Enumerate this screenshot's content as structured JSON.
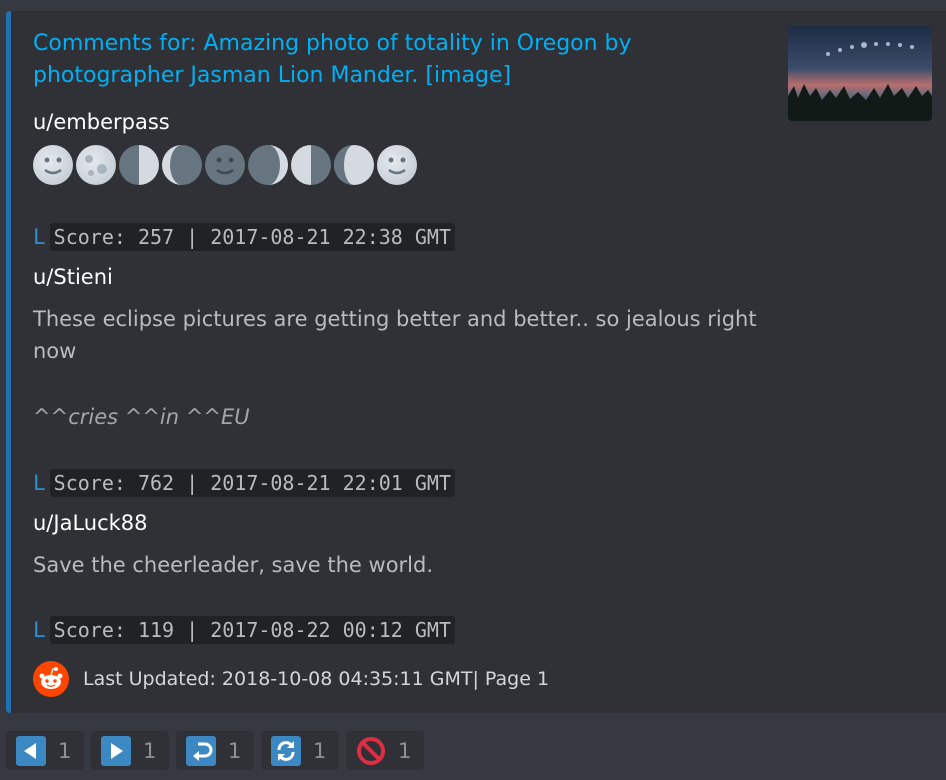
{
  "embed": {
    "title": "Comments for: Amazing photo of totality in Oregon by photographer Jasman Lion Mander. [image]",
    "post_author": "u/emberpass",
    "moon_emojis": [
      "full-moon-face-icon",
      "full-moon-icon",
      "waning-gibbous-icon",
      "last-quarter-icon",
      "new-moon-face-icon",
      "waning-crescent-icon",
      "first-quarter-icon",
      "waxing-gibbous-icon",
      "full-moon-face-icon"
    ],
    "comments": [
      {
        "score_line": "Score: 257 | 2017-08-21 22:38 GMT",
        "author": "u/Stieni",
        "text": "These eclipse pictures are getting better and better.. so jealous right now",
        "italic": "^^cries ^^in ^^EU"
      },
      {
        "score_line": "Score: 762 | 2017-08-21 22:01 GMT",
        "author": "u/JaLuck88",
        "text": "Save the cheerleader, save the world."
      },
      {
        "score_line": "Score: 119 | 2017-08-22 00:12 GMT"
      }
    ],
    "arrow_glyph": "L",
    "footer": "Last Updated: 2018-10-08 04:35:11 GMT| Page 1"
  },
  "reactions": [
    {
      "icon": "arrow-left-icon",
      "count": "1",
      "color": "#3b88c3"
    },
    {
      "icon": "arrow-right-icon",
      "count": "1",
      "color": "#3b88c3"
    },
    {
      "icon": "return-arrow-icon",
      "count": "1",
      "color": "#3b88c3"
    },
    {
      "icon": "refresh-icon",
      "count": "1",
      "color": "#3b88c3"
    },
    {
      "icon": "no-entry-icon",
      "count": "1",
      "color": "#dd2e44"
    }
  ],
  "colors": {
    "accent_bar": "#2271b1",
    "link": "#00b0f4",
    "reddit_orange": "#ff4500"
  }
}
